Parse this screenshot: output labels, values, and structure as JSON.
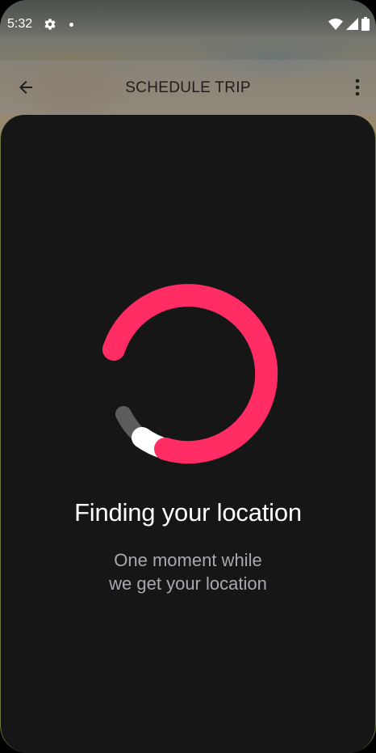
{
  "status_bar": {
    "time": "5:32",
    "icons": [
      "gear-icon",
      "notification-dot-icon",
      "wifi-icon",
      "cellular-signal-icon",
      "battery-icon"
    ]
  },
  "app_bar": {
    "title": "SCHEDULE TRIP",
    "back_icon": "arrow-left-icon",
    "menu_icon": "more-vertical-icon"
  },
  "loading": {
    "heading": "Finding your location",
    "message_line1": "One moment while",
    "message_line2": "we get your location"
  },
  "colors": {
    "accent": "#ff2d64",
    "sheet_background": "#161617",
    "secondary_text": "#a6a9b0"
  }
}
